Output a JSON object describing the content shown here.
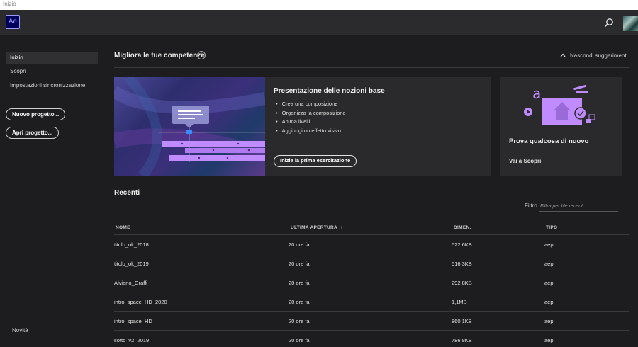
{
  "window": {
    "title": "Inizio"
  },
  "header": {
    "app_logo": "Ae",
    "search_icon": "search-icon",
    "avatar_icon": "user-avatar"
  },
  "sidebar": {
    "nav": [
      {
        "label": "Inizio",
        "active": true
      },
      {
        "label": "Scopri",
        "active": false
      },
      {
        "label": "Impostazioni sincronizzazione",
        "active": false
      }
    ],
    "new_project": "Nuovo progetto...",
    "open_project": "Apri progetto...",
    "news": "Novità"
  },
  "skills": {
    "title": "Migliora le tue competenze",
    "info_icon": "i",
    "hide_label": "Nascondi suggerimenti",
    "main_card": {
      "title": "Presentazione delle nozioni base",
      "bullets": [
        "Crea una composizione",
        "Organizza la composizione",
        "Anima livelli",
        "Aggiungi un effetto visivo"
      ],
      "button": "Inizia la prima esercitazione"
    },
    "side_card": {
      "title": "Prova qualcosa di nuovo",
      "link": "Vai a Scopri"
    }
  },
  "recent": {
    "title": "Recenti",
    "filter_label": "Filtro",
    "filter_placeholder": "Filtra per file recenti",
    "columns": [
      "NOME",
      "ULTIMA APERTURA",
      "DIMEN.",
      "TIPO"
    ],
    "sort_arrow": "↑",
    "rows": [
      {
        "name": "titolo_ok_2018",
        "opened": "20 ore fa",
        "size": "522,6KB",
        "type": "aep"
      },
      {
        "name": "titolo_ok_2019",
        "opened": "20 ore fa",
        "size": "516,3KB",
        "type": "aep"
      },
      {
        "name": "Alviano_Graffi",
        "opened": "20 ore fa",
        "size": "292,8KB",
        "type": "aep"
      },
      {
        "name": "intro_space_HD_2020_",
        "opened": "20 ore fa",
        "size": "1,1MB",
        "type": "aep"
      },
      {
        "name": "intro_space_HD_",
        "opened": "20 ore fa",
        "size": "860,1KB",
        "type": "aep"
      },
      {
        "name": "sotto_v2_2019",
        "opened": "20 ore fa",
        "size": "786,8KB",
        "type": "aep"
      }
    ]
  },
  "colors": {
    "accent": "#9999ff",
    "background": "#1d1d1f",
    "card": "#2a2a2c",
    "illustration": "#c08bff"
  }
}
